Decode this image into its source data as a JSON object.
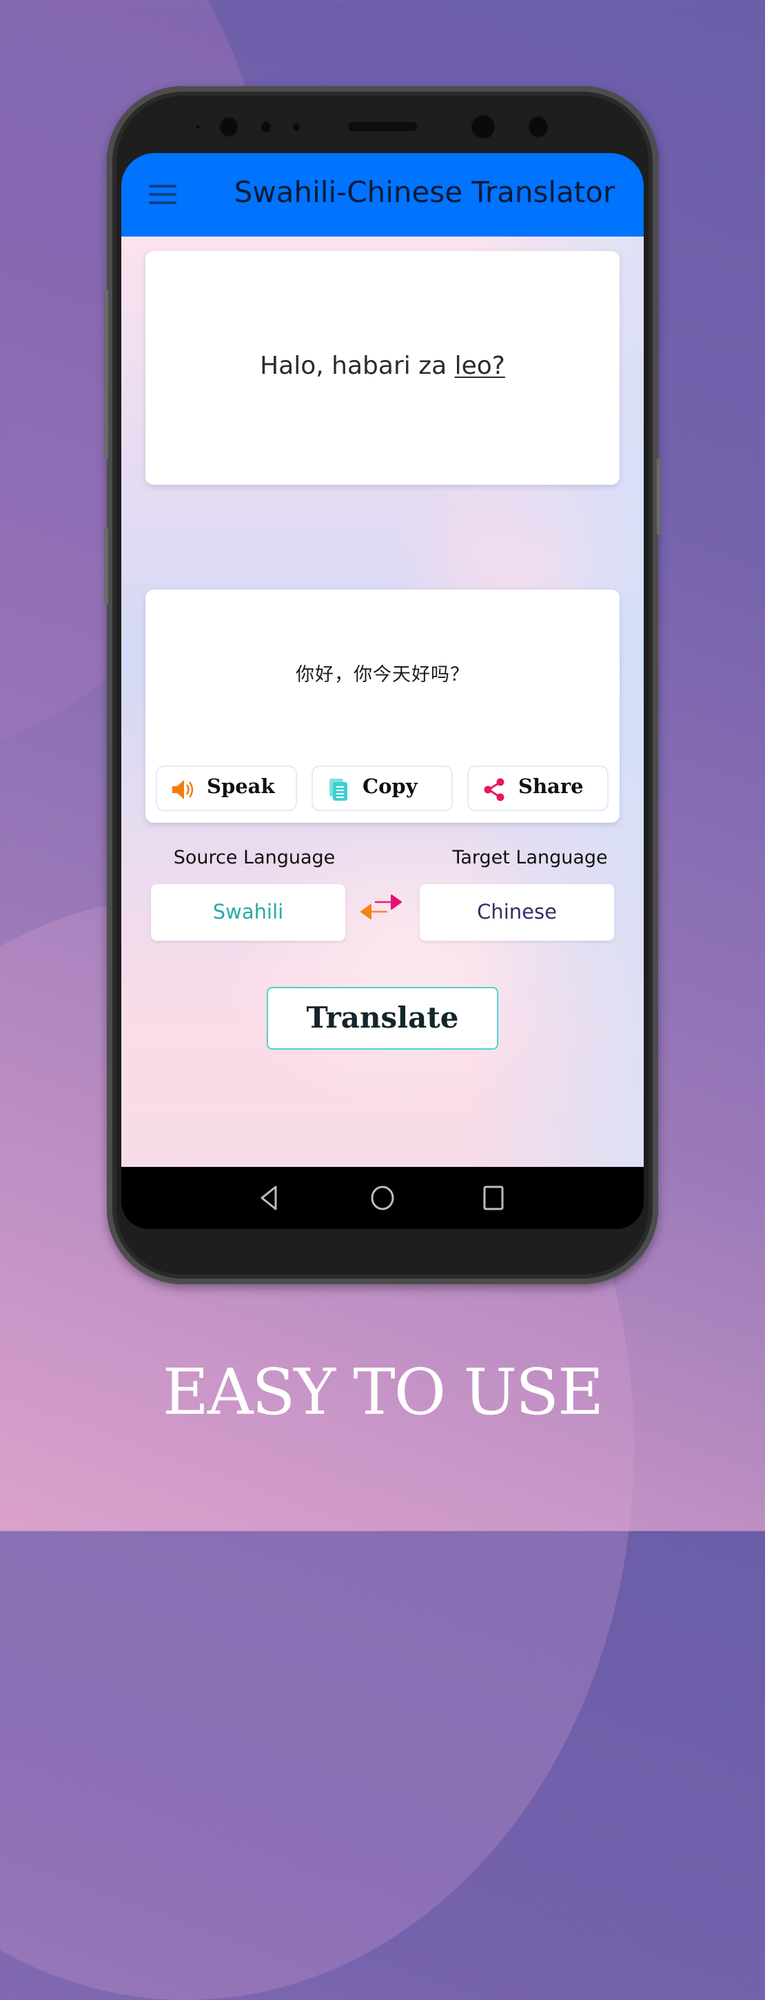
{
  "app": {
    "title": "Swahili-Chinese Translator",
    "menu_icon": "hamburger-menu-icon",
    "header_color": "#0073ff"
  },
  "input": {
    "text_before": "Halo, habari za ",
    "text_underlined": "leo?"
  },
  "mic": {
    "icon": "microphone-icon",
    "color": "#e8185f"
  },
  "output": {
    "text": "你好，你今天好吗？",
    "actions": [
      {
        "label": "Speak",
        "icon": "speaker-icon",
        "color": "#f47c0c"
      },
      {
        "label": "Copy",
        "icon": "copy-icon",
        "color": "#3ecfd3"
      },
      {
        "label": "Share",
        "icon": "share-icon",
        "color": "#ea1560"
      }
    ]
  },
  "languages": {
    "source_label": "Source Language",
    "source_value": "Swahili",
    "source_color": "#2aaaa8",
    "target_label": "Target Language",
    "target_value": "Chinese",
    "target_color": "#3b2a66",
    "swap_icon": "swap-arrows-icon"
  },
  "translate_button": {
    "label": "Translate",
    "border_color": "#52cfd0"
  },
  "navbar": {
    "icons": [
      "back-icon",
      "home-icon",
      "recents-icon"
    ]
  },
  "promo": {
    "tagline": "EASY TO USE"
  }
}
